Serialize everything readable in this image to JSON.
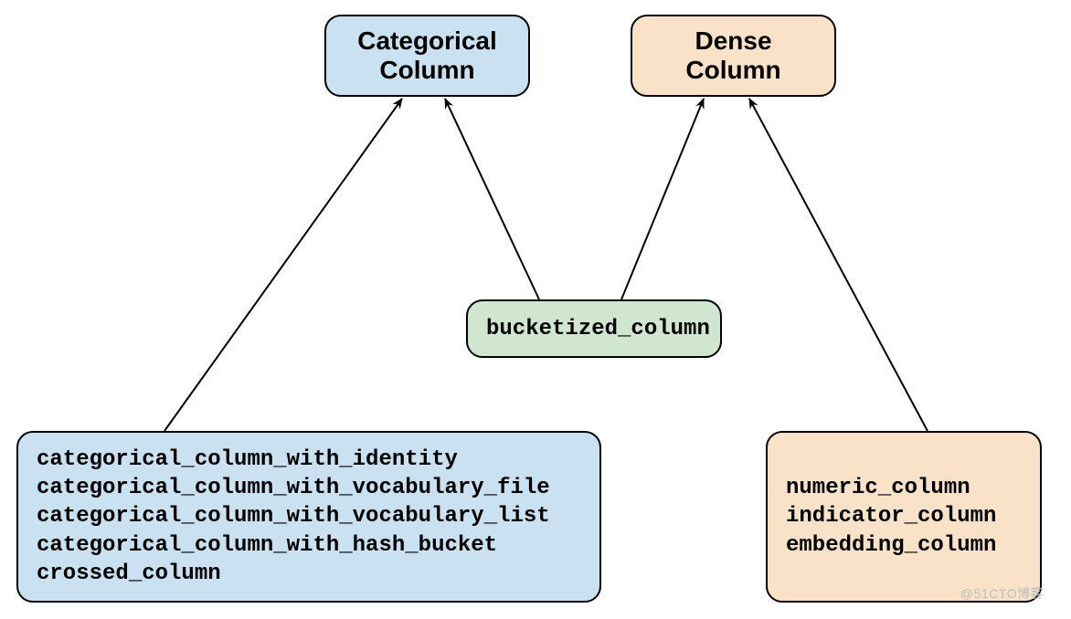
{
  "colors": {
    "blue_fill": "#cae1f1",
    "green_fill": "#d1e6d0",
    "orange_fill": "#f9e2c7",
    "stroke": "#000000"
  },
  "nodes": {
    "categorical_header": {
      "line1": "Categorical",
      "line2": "Column"
    },
    "dense_header": {
      "line1": "Dense",
      "line2": "Column"
    },
    "bucketized": {
      "label": "bucketized_column"
    },
    "categorical_list": {
      "items": [
        "categorical_column_with_identity",
        "categorical_column_with_vocabulary_file",
        "categorical_column_with_vocabulary_list",
        "categorical_column_with_hash_bucket",
        "crossed_column"
      ]
    },
    "dense_list": {
      "items": [
        "numeric_column",
        "indicator_column",
        "embedding_column"
      ]
    }
  },
  "watermark": "@51CTO博客"
}
